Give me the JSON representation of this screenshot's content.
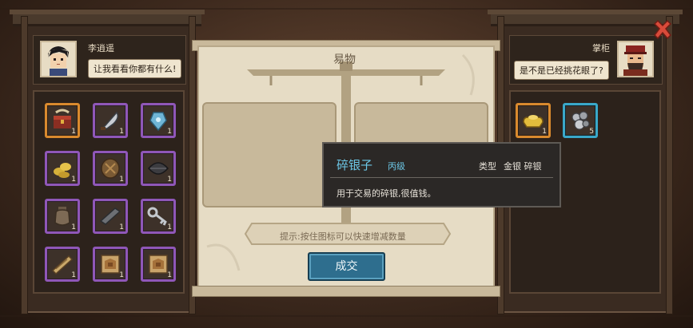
{
  "window": {
    "close_icon": "close-x-icon"
  },
  "player": {
    "name": "李逍遥",
    "speech": "让我看看你都有什么!"
  },
  "merchant": {
    "name": "掌柜",
    "speech": "是不是已经挑花眼了?"
  },
  "trade": {
    "title": "易物",
    "hint": "提示:按住图标可以快速增减数量",
    "confirm_label": "成交"
  },
  "player_inventory": [
    {
      "icon": "treasure-chest-icon",
      "count": "1",
      "rarity": "orange"
    },
    {
      "icon": "curved-blade-icon",
      "count": "1",
      "rarity": "purple"
    },
    {
      "icon": "jade-ornament-icon",
      "count": "1",
      "rarity": "purple"
    },
    {
      "icon": "gold-ingot-pile-icon",
      "count": "1",
      "rarity": "purple"
    },
    {
      "icon": "tortoise-shell-icon",
      "count": "1",
      "rarity": "purple"
    },
    {
      "icon": "black-leaf-icon",
      "count": "1",
      "rarity": "purple"
    },
    {
      "icon": "clay-jar-icon",
      "count": "1",
      "rarity": "purple"
    },
    {
      "icon": "iron-bar-icon",
      "count": "1",
      "rarity": "purple"
    },
    {
      "icon": "key-icon",
      "count": "1",
      "rarity": "purple"
    },
    {
      "icon": "scroll-stick-icon",
      "count": "1",
      "rarity": "purple"
    },
    {
      "icon": "map-scroll-icon",
      "count": "1",
      "rarity": "purple"
    },
    {
      "icon": "map-scroll-icon",
      "count": "1",
      "rarity": "purple"
    }
  ],
  "merchant_inventory": [
    {
      "icon": "gold-ingot-icon",
      "count": "1",
      "rarity": "orange"
    },
    {
      "icon": "silver-pieces-icon",
      "count": "5",
      "rarity": "blue"
    }
  ],
  "tooltip": {
    "item_name": "碎银子",
    "grade": "丙级",
    "type_label": "类型",
    "type_value": "金银 碎银",
    "description": "用于交易的碎银,很值钱。"
  },
  "colors": {
    "purple_rarity": "#8f57b8",
    "orange_rarity": "#d98a2e",
    "blue_rarity": "#3aa8c9",
    "tooltip_name": "#6cc7e6",
    "confirm_button": "#2e6e8e"
  }
}
